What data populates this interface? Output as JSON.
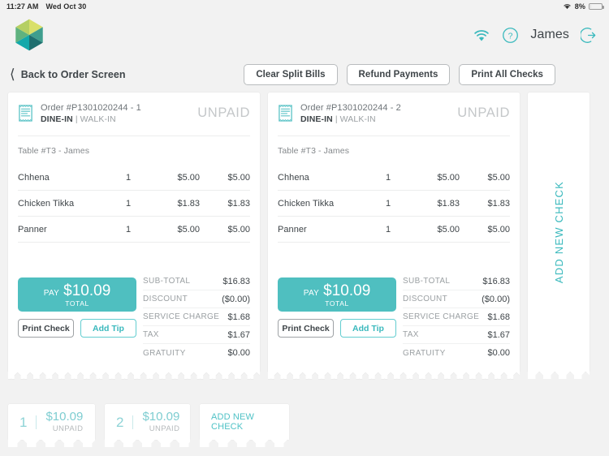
{
  "statusbar": {
    "time": "11:27 AM",
    "date": "Wed Oct 30",
    "battery_percent": "8%",
    "wifi_icon": "wifi-icon",
    "battery_icon": "battery-icon"
  },
  "header": {
    "logo_icon": "hexagon-logo-icon",
    "wifi_icon": "wifi-icon",
    "help_icon": "help-circle-icon",
    "user_name": "James",
    "logout_icon": "logout-arrow-icon"
  },
  "toolbar": {
    "back_label": "Back to Order Screen",
    "back_icon": "chevron-left-icon",
    "buttons": [
      {
        "label": "Clear Split Bills"
      },
      {
        "label": "Refund Payments"
      },
      {
        "label": "Print All Checks"
      }
    ]
  },
  "checks": [
    {
      "receipt_icon": "receipt-icon",
      "order_number": "Order #P1301020244 - 1",
      "order_type_primary": "DINE-IN",
      "order_type_separator": " | ",
      "order_type_secondary": "WALK-IN",
      "status": "UNPAID",
      "table_line": "Table #T3 - James",
      "items": [
        {
          "name": "Chhena",
          "qty": "1",
          "price": "$5.00",
          "total": "$5.00"
        },
        {
          "name": "Chicken Tikka",
          "qty": "1",
          "price": "$1.83",
          "total": "$1.83"
        },
        {
          "name": "Panner",
          "qty": "1",
          "price": "$5.00",
          "total": "$5.00"
        }
      ],
      "totals": [
        {
          "label": "SUB-TOTAL",
          "value": "$16.83"
        },
        {
          "label": "DISCOUNT",
          "value": "($0.00)"
        },
        {
          "label": "SERVICE CHARGE",
          "value": "$1.68"
        },
        {
          "label": "TAX",
          "value": "$1.67"
        },
        {
          "label": "GRATUITY",
          "value": "$0.00"
        }
      ],
      "pay_label": "PAY",
      "pay_amount": "$10.09",
      "pay_total_label": "TOTAL",
      "print_check_label": "Print Check",
      "add_tip_label": "Add Tip"
    },
    {
      "receipt_icon": "receipt-icon",
      "order_number": "Order #P1301020244 - 2",
      "order_type_primary": "DINE-IN",
      "order_type_separator": " | ",
      "order_type_secondary": "WALK-IN",
      "status": "UNPAID",
      "table_line": "Table #T3 - James",
      "items": [
        {
          "name": "Chhena",
          "qty": "1",
          "price": "$5.00",
          "total": "$5.00"
        },
        {
          "name": "Chicken Tikka",
          "qty": "1",
          "price": "$1.83",
          "total": "$1.83"
        },
        {
          "name": "Panner",
          "qty": "1",
          "price": "$5.00",
          "total": "$5.00"
        }
      ],
      "totals": [
        {
          "label": "SUB-TOTAL",
          "value": "$16.83"
        },
        {
          "label": "DISCOUNT",
          "value": "($0.00)"
        },
        {
          "label": "SERVICE CHARGE",
          "value": "$1.68"
        },
        {
          "label": "TAX",
          "value": "$1.67"
        },
        {
          "label": "GRATUITY",
          "value": "$0.00"
        }
      ],
      "pay_label": "PAY",
      "pay_amount": "$10.09",
      "pay_total_label": "TOTAL",
      "print_check_label": "Print Check",
      "add_tip_label": "Add Tip"
    }
  ],
  "add_check_panel": {
    "label": "ADD NEW CHECK"
  },
  "bottom_tabs": [
    {
      "number": "1",
      "amount": "$10.09",
      "state": "UNPAID"
    },
    {
      "number": "2",
      "amount": "$10.09",
      "state": "UNPAID"
    }
  ],
  "bottom_add_tab": {
    "label": "ADD NEW CHECK"
  },
  "colors": {
    "accent_teal": "#4fbfc0",
    "accent_teal_light": "#7ecdd1",
    "text_dark": "#3f4549",
    "text_muted": "#9ba0a3",
    "page_bg": "#f2f2f2",
    "card_bg": "#ffffff"
  }
}
